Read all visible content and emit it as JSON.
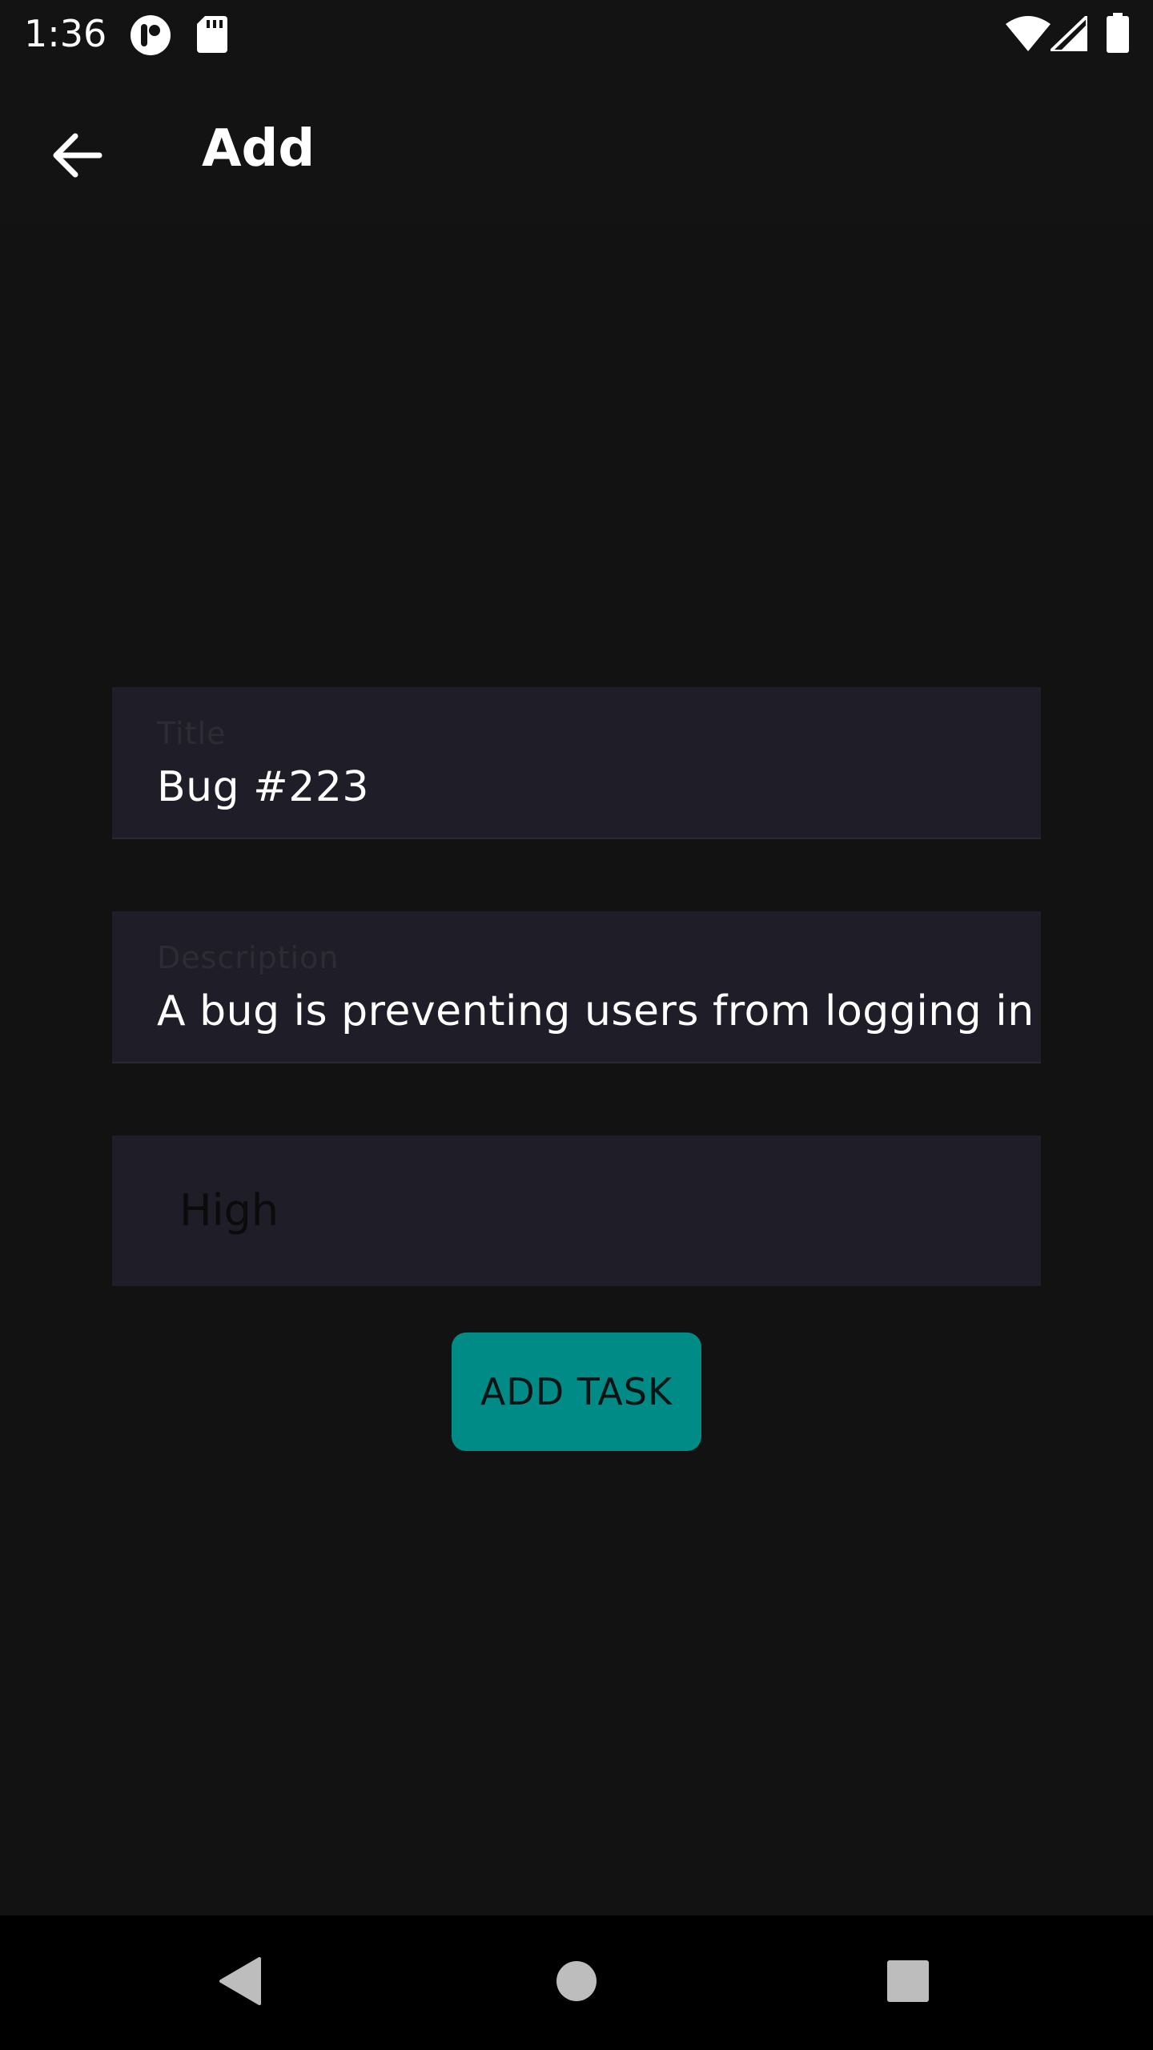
{
  "status_bar": {
    "time": "1:36",
    "icons": [
      "notification-app-icon",
      "sd-card-icon",
      "wifi-icon",
      "signal-icon",
      "battery-icon"
    ]
  },
  "app_bar": {
    "back_icon": "arrow-back-icon",
    "title": "Add"
  },
  "form": {
    "title_field": {
      "label": "Title",
      "value": "Bug #223"
    },
    "description_field": {
      "label": "Description",
      "value": "A bug is preventing users from logging in"
    },
    "priority_dropdown": {
      "selected": "High"
    },
    "submit_label": "ADD TASK"
  },
  "nav_bar": {
    "icons": [
      "back-triangle-icon",
      "home-circle-icon",
      "recents-square-icon"
    ]
  },
  "colors": {
    "background": "#121212",
    "field_background": "#1f1d27",
    "accent": "#008b87",
    "nav_background": "#000000"
  }
}
